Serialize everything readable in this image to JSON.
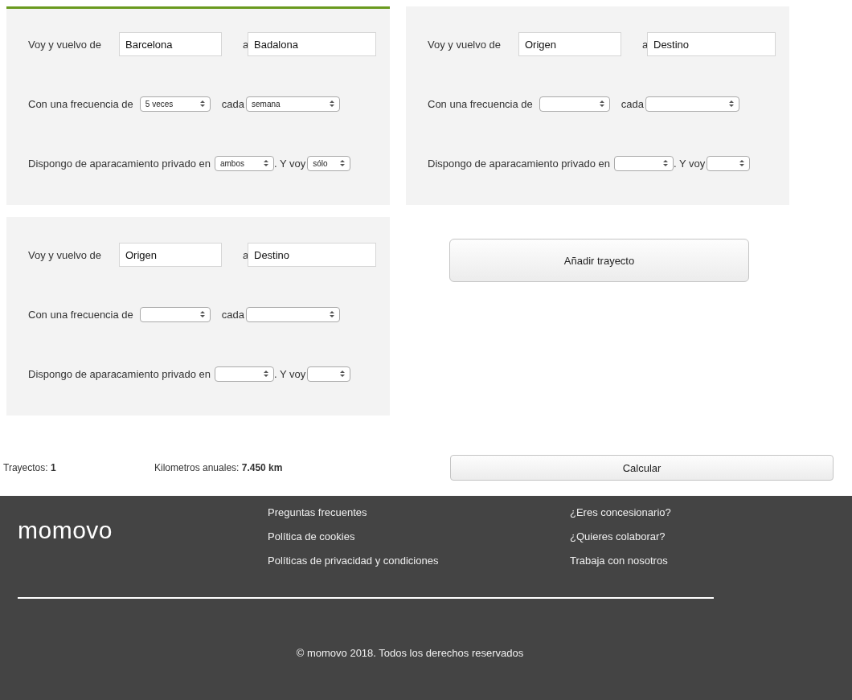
{
  "trips": [
    {
      "selected": true,
      "from_label": "Voy y vuelvo de",
      "origin": {
        "value": "Barcelona"
      },
      "to_label": "a",
      "destination": {
        "value": "Badalona"
      },
      "frequency_label": "Con una frecuencia de",
      "frequency": {
        "value": "5 veces"
      },
      "period_label": "cada",
      "period": {
        "value": "semana"
      },
      "parking_label": "Dispongo de aparacamiento privado en",
      "parking": {
        "value": "ambos"
      },
      "company_label": ". Y voy",
      "company": {
        "value": "sólo"
      }
    },
    {
      "selected": false,
      "from_label": "Voy y vuelvo de",
      "origin": {
        "value": "Origen"
      },
      "to_label": "a",
      "destination": {
        "value": "Destino"
      },
      "frequency_label": "Con una frecuencia de",
      "period_label": "cada",
      "parking_label": "Dispongo de aparacamiento privado en",
      "company_label": ". Y voy"
    },
    {
      "selected": false,
      "from_label": "Voy y vuelvo de",
      "origin": {
        "value": "Origen"
      },
      "to_label": "a",
      "destination": {
        "value": "Destino"
      },
      "frequency_label": "Con una frecuencia de",
      "period_label": "cada",
      "parking_label": "Dispongo de aparacamiento privado en",
      "company_label": ". Y voy"
    }
  ],
  "add_button": "Añadir trayecto",
  "summary": {
    "trips": "Trayectos: **1**",
    "kilometers": "Kilometros anuales: **7.450 km**",
    "calculate_button": "Calcular"
  },
  "footer": {
    "logo": "momovo",
    "links_1": [
      "Preguntas frecuentes",
      "Política de cookies",
      "Políticas de privacidad y condiciones"
    ],
    "links_2": [
      "¿Eres concesionario?",
      "¿Quieres colaborar?",
      "Trabaja con nosotros"
    ],
    "copyright": "© momovo 2018. Todos los derechos reservados"
  }
}
